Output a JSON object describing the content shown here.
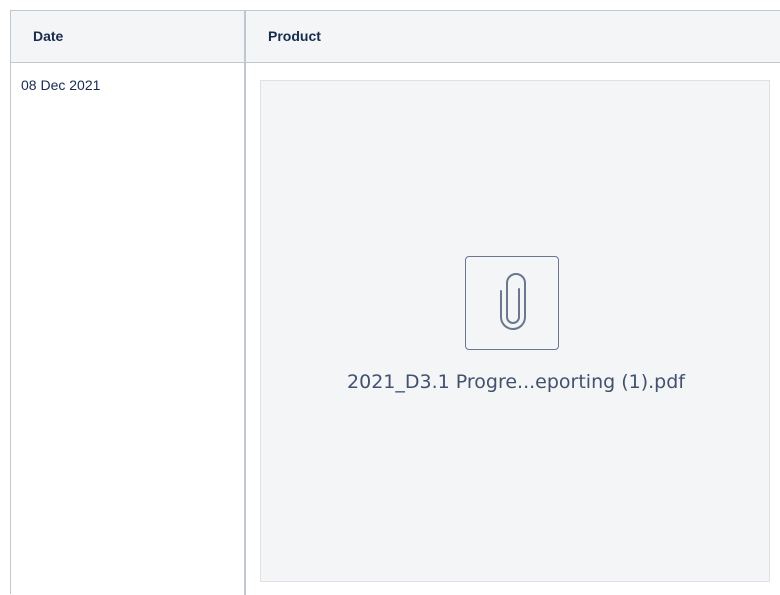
{
  "table": {
    "columns": [
      "Date",
      "Product"
    ],
    "rows": [
      {
        "date": "08 Dec 2021",
        "product": {
          "type": "attachment",
          "icon": "paperclip-icon",
          "file_name": "2021_D3.1 Progre...eporting (1).pdf"
        }
      }
    ]
  },
  "colors": {
    "header_bg": "#f4f5f7",
    "border": "#c1c7d0",
    "card_bg": "#f4f5f7",
    "text": "#172b4d"
  }
}
